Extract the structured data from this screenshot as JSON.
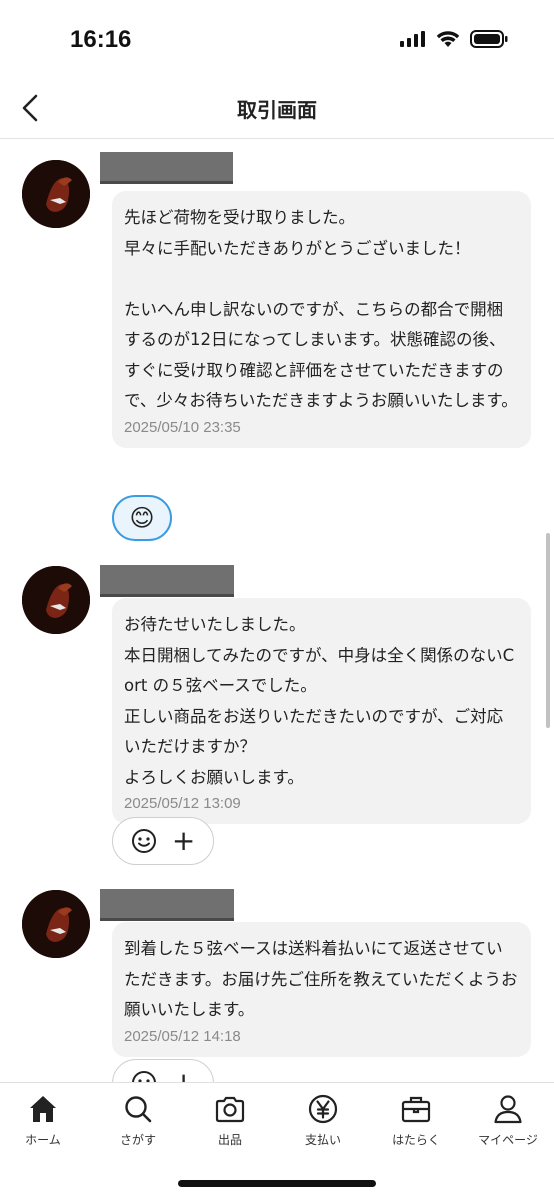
{
  "status_bar": {
    "time": "16:16"
  },
  "header": {
    "title": "取引画面"
  },
  "messages": [
    {
      "text": "先ほど荷物を受け取りました。\n早々に手配いただきありがとうございました！\n\nたいへん申し訳ないのですが、こちらの都合で開梱するのが12日になってしまいます。状態確認の後、すぐに受け取り確認と評価をさせていただきますので、少々お待ちいただきますようお願いいたします。",
      "time": "2025/05/10 23:35",
      "reaction": "😊"
    },
    {
      "text": "お待たせいたしました。\n本日開梱してみたのですが、中身は全く関係のないCort の５弦ベースでした。\n正しい商品をお送りいただきたいのですが、ご対応いただけますか？\nよろしくお願いします。",
      "time": "2025/05/12 13:09",
      "reaction_add": {
        "emoji_icon": "smiley-outline-icon",
        "plus_label": "+"
      }
    },
    {
      "text": "到着した５弦ベースは送料着払いにて返送させていただきます。お届け先ご住所を教えていただくようお願いいたします。",
      "time": "2025/05/12 14:18",
      "reaction_add": {
        "emoji_icon": "smiley-outline-icon",
        "plus_label": "+"
      }
    }
  ],
  "tab_bar": {
    "items": [
      {
        "label": "ホーム",
        "icon": "home-icon"
      },
      {
        "label": "さがす",
        "icon": "search-icon"
      },
      {
        "label": "出品",
        "icon": "camera-icon"
      },
      {
        "label": "支払い",
        "icon": "yen-icon"
      },
      {
        "label": "はたらく",
        "icon": "briefcase-icon"
      },
      {
        "label": "マイページ",
        "icon": "person-icon"
      }
    ]
  },
  "colors": {
    "accent": "#3b9be0",
    "bubble": "#f2f2f2",
    "timestamp": "#8a8a8a"
  }
}
